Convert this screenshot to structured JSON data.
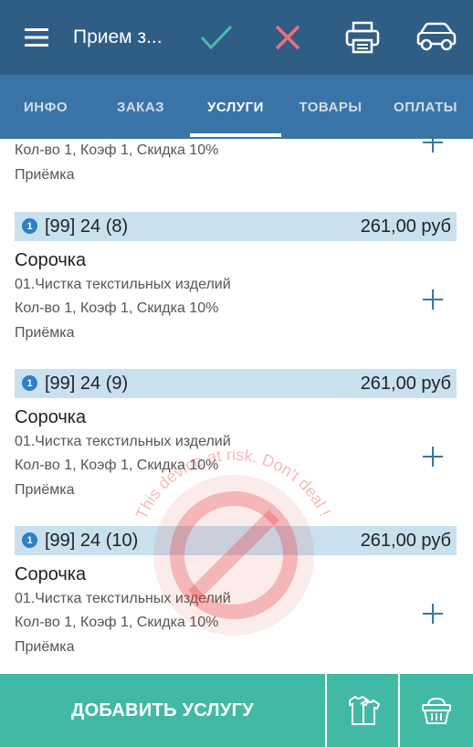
{
  "toolbar": {
    "title": "Прием з...",
    "icons": [
      "menu-icon",
      "check-icon",
      "close-icon",
      "print-icon",
      "car-icon"
    ]
  },
  "tabs": [
    {
      "label": "ИНФО"
    },
    {
      "label": "ЗАКАЗ"
    },
    {
      "label": "УСЛУГИ",
      "active": true
    },
    {
      "label": "ТОВАРЫ"
    },
    {
      "label": "ОПЛАТЫ"
    }
  ],
  "partial_item": {
    "details": "Кол-во 1, Коэф 1, Скидка 10%",
    "status": "Приёмка"
  },
  "items": [
    {
      "badge": "1",
      "code": "[99] 24 (8)",
      "price": "261,00 руб",
      "name": "Сорочка",
      "service": "01.Чистка текстильных изделий",
      "details": "Кол-во 1, Коэф 1, Скидка 10%",
      "status": "Приёмка"
    },
    {
      "badge": "1",
      "code": "[99] 24 (9)",
      "price": "261,00 руб",
      "name": "Сорочка",
      "service": "01.Чистка текстильных изделий",
      "details": "Кол-во 1, Коэф 1, Скидка 10%",
      "status": "Приёмка"
    },
    {
      "badge": "1",
      "code": "[99] 24 (10)",
      "price": "261,00 руб",
      "name": "Сорочка",
      "service": "01.Чистка текстильных изделий",
      "details": "Кол-во 1, Коэф 1, Скидка 10%",
      "status": "Приёмка"
    }
  ],
  "watermark": {
    "text": "This device at risk. Don't deal !",
    "color": "#e23b3b"
  },
  "bottom_bar": {
    "add_label": "ДОБАВИТЬ УСЛУГУ",
    "icons": [
      "shirts-icon",
      "basket-icon"
    ]
  },
  "colors": {
    "toolbar": "#2f5d86",
    "tabs": "#3a74a6",
    "item_header": "#c9e0ef",
    "accent_green": "#42b9a5",
    "close_red": "#ef6f79",
    "check_green": "#45c0a8"
  }
}
